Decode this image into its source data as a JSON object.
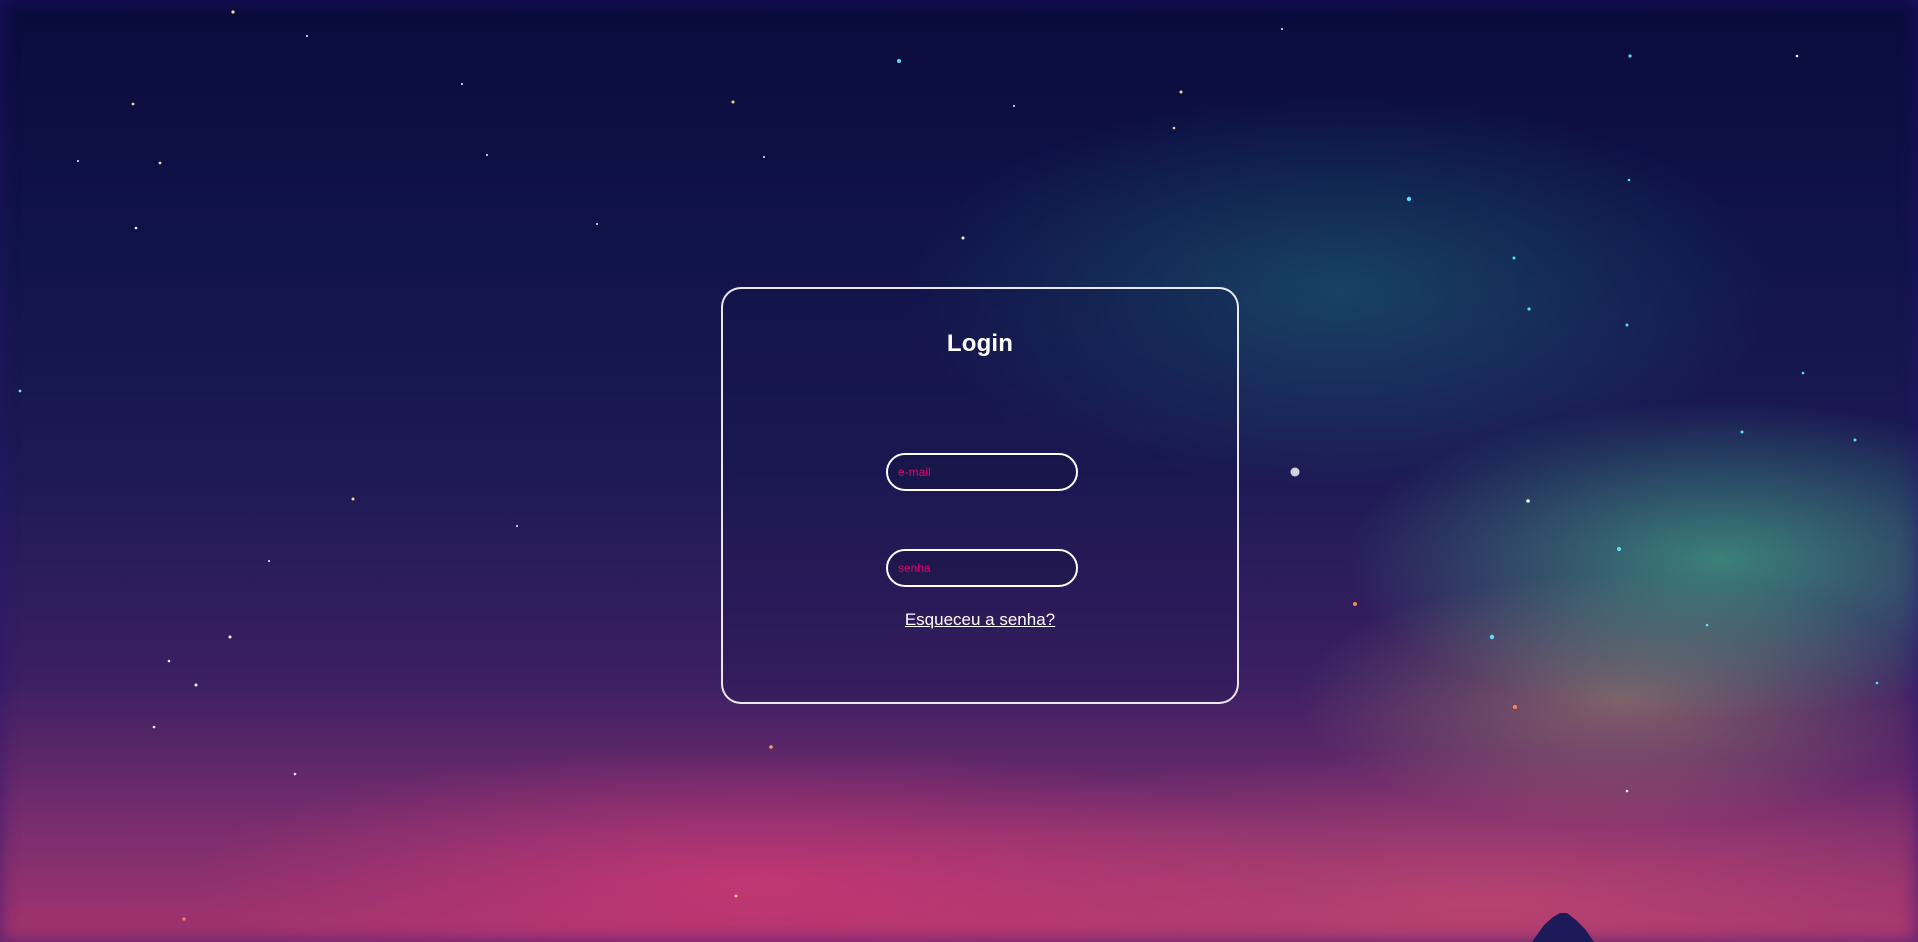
{
  "login": {
    "title": "Login",
    "email_placeholder": "e-mail",
    "password_placeholder": "senha",
    "forgot_password": "Esqueceu a senha?"
  },
  "colors": {
    "card_border": "#ffffff",
    "title_text": "#ffffff",
    "placeholder_text": "#e4006b",
    "background_top": "#0a0b3d",
    "background_bottom": "#a4346d",
    "aurora_green": "#46be8c"
  },
  "icons": {
    "background_scene": "night-sky-illustration",
    "foreground_shape": "mountain-silhouette"
  }
}
